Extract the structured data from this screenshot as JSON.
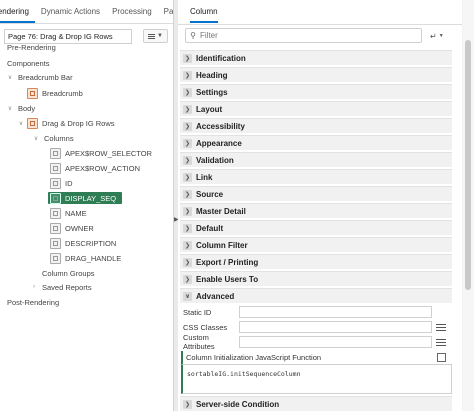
{
  "left_panel": {
    "tabs": [
      "Rendering",
      "Dynamic Actions",
      "Processing",
      "Page Shar"
    ],
    "page_select": "Page 76: Drag & Drop IG Rows",
    "tree": [
      {
        "label": "Pre-Rendering"
      },
      {
        "label": "Components"
      },
      {
        "label": "Breadcrumb Bar"
      },
      {
        "label": "Breadcrumb"
      },
      {
        "label": "Body"
      },
      {
        "label": "Drag & Drop IG Rows"
      },
      {
        "label": "Columns"
      },
      {
        "label": "APEX$ROW_SELECTOR"
      },
      {
        "label": "APEX$ROW_ACTION"
      },
      {
        "label": "ID"
      },
      {
        "label": "DISPLAY_SEQ"
      },
      {
        "label": "NAME"
      },
      {
        "label": "OWNER"
      },
      {
        "label": "DESCRIPTION"
      },
      {
        "label": "DRAG_HANDLE"
      },
      {
        "label": "Column Groups"
      },
      {
        "label": "Saved Reports"
      },
      {
        "label": "Post-Rendering"
      }
    ]
  },
  "right_panel": {
    "tab": "Column",
    "filter_placeholder": "Filter",
    "groups": [
      "Identification",
      "Heading",
      "Settings",
      "Layout",
      "Accessibility",
      "Appearance",
      "Validation",
      "Link",
      "Source",
      "Master Detail",
      "Default",
      "Column Filter",
      "Export / Printing",
      "Enable Users To",
      "Advanced",
      "Server-side Condition"
    ],
    "advanced": {
      "static_id_label": "Static ID",
      "css_classes_label": "CSS Classes",
      "custom_attributes_label": "Custom Attributes",
      "js_function_label": "Column Initialization JavaScript Function",
      "js_function_value": "sortableIG.initSequenceColumn"
    }
  }
}
